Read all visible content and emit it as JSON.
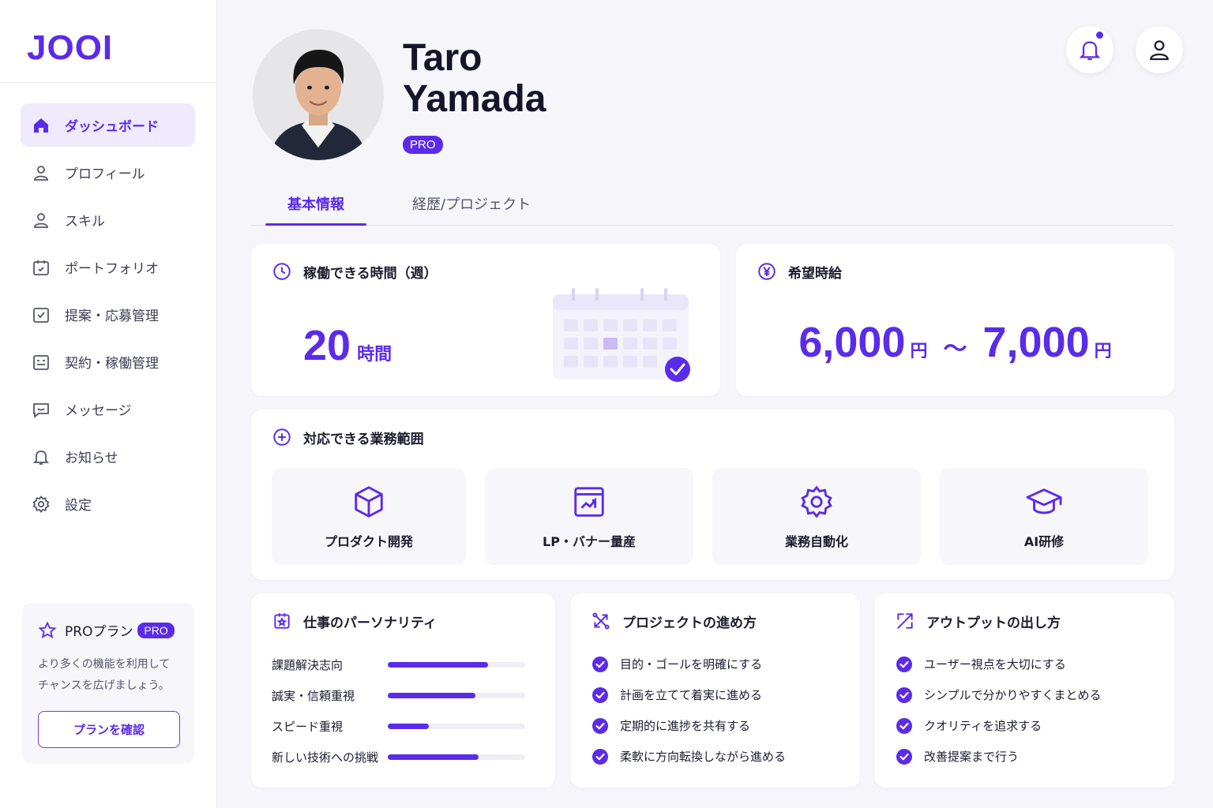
{
  "brand": {
    "logo": "JOOI"
  },
  "sidebar": {
    "items": [
      {
        "label": "ダッシュボード",
        "icon": "home-icon",
        "active": true
      },
      {
        "label": "プロフィール",
        "icon": "user-icon"
      },
      {
        "label": "スキル",
        "icon": "user-icon"
      },
      {
        "label": "ポートフォリオ",
        "icon": "calendar-icon"
      },
      {
        "label": "提案・応募管理",
        "icon": "checkbox-icon"
      },
      {
        "label": "契約・稼働管理",
        "icon": "calendar-icon"
      },
      {
        "label": "メッセージ",
        "icon": "chat-icon"
      },
      {
        "label": "お知らせ",
        "icon": "bell-icon"
      },
      {
        "label": "設定",
        "icon": "gear-icon"
      }
    ],
    "pro_card": {
      "title": "PROプラン",
      "badge": "PRO",
      "description_line1": "より多くの機能を利用して",
      "description_line2": "チャンスを広げましょう。",
      "button": "プランを確認"
    }
  },
  "profile": {
    "first_name": "Taro",
    "last_name": "Yamada",
    "badge": "PRO"
  },
  "tabs": [
    {
      "label": "基本情報",
      "active": true
    },
    {
      "label": "経歴/プロジェクト"
    }
  ],
  "availability": {
    "title": "稼働できる時間（週）",
    "value": "20",
    "unit": "時間"
  },
  "rate": {
    "title": "希望時給",
    "min": "6,000",
    "max": "7,000",
    "unit": "円",
    "separator": "〜"
  },
  "business_scope": {
    "title": "対応できる業務範囲",
    "items": [
      {
        "label": "プロダクト開発",
        "icon": "cube-icon"
      },
      {
        "label": "LP・バナー量産",
        "icon": "image-frame-icon"
      },
      {
        "label": "業務自動化",
        "icon": "gear-icon"
      },
      {
        "label": "AI研修",
        "icon": "graduation-cap-icon"
      }
    ]
  },
  "personality": {
    "title": "仕事のパーソナリティ",
    "traits": [
      {
        "label": "課題解決志向",
        "level": 0.73
      },
      {
        "label": "誠実・信頼重視",
        "level": 0.64
      },
      {
        "label": "スピード重視",
        "level": 0.3
      },
      {
        "label": "新しい技術への挑戦",
        "level": 0.66
      }
    ]
  },
  "project_style": {
    "title": "プロジェクトの進め方",
    "items": [
      "目的・ゴールを明確にする",
      "計画を立てて着実に進める",
      "定期的に進捗を共有する",
      "柔軟に方向転換しながら進める"
    ]
  },
  "output_style": {
    "title": "アウトプットの出し方",
    "items": [
      "ユーザー視点を大切にする",
      "シンプルで分かりやすくまとめる",
      "クオリティを追求する",
      "改善提案まで行う"
    ]
  },
  "colors": {
    "accent": "#5b2bea",
    "accent_light": "#efeafd",
    "background": "#f6f6fa"
  }
}
